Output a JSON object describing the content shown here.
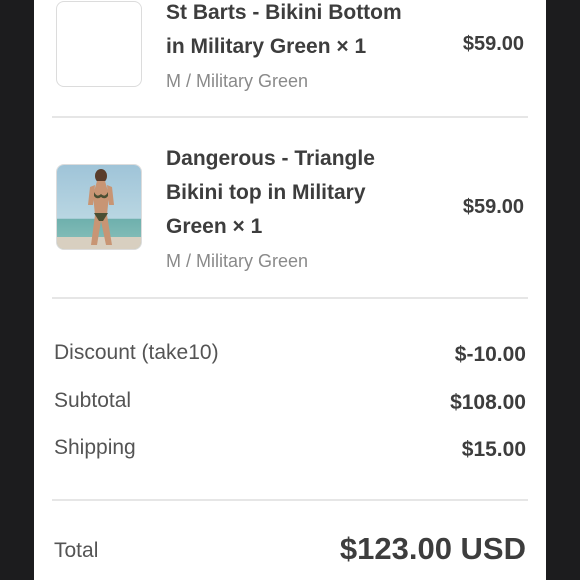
{
  "items": [
    {
      "title_line1": "St Barts - Bikini Bottom",
      "title_line2": "in Military Green × 1",
      "variant": "M / Military Green",
      "price": "$59.00"
    },
    {
      "title_line1": "Dangerous - Triangle",
      "title_line2": "Bikini top in Military",
      "title_line3": "Green × 1",
      "variant": "M / Military Green",
      "price": "$59.00"
    }
  ],
  "summary": {
    "discount_label": "Discount (take10)",
    "discount_value": "$-10.00",
    "subtotal_label": "Subtotal",
    "subtotal_value": "$108.00",
    "shipping_label": "Shipping",
    "shipping_value": "$15.00",
    "total_label": "Total",
    "total_value": "$123.00 USD"
  },
  "colors": {
    "background": "#1c1c1e",
    "panel": "#ffffff",
    "text_primary": "#3d3d3d",
    "text_secondary": "#8a8a8a",
    "divider": "#e6e6e6"
  }
}
